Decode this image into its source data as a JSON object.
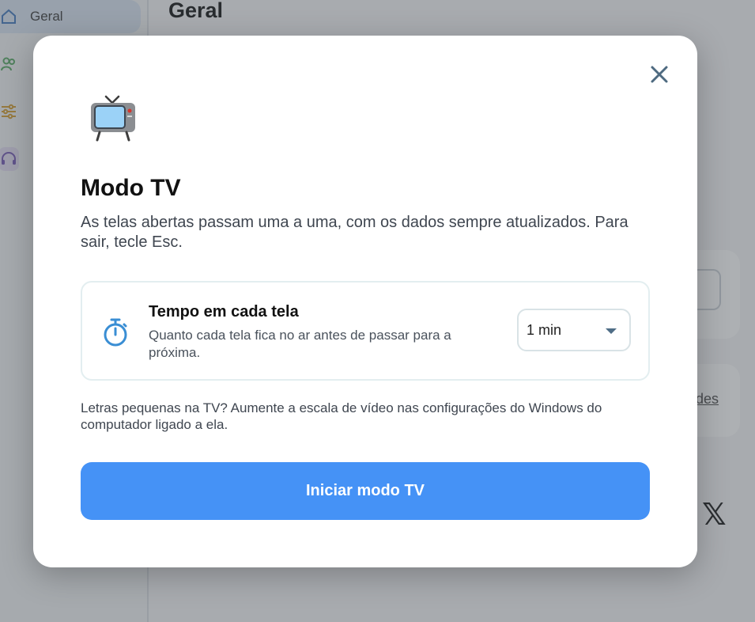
{
  "background": {
    "sidebar": {
      "items": [
        {
          "label": "Geral",
          "icon": "home-icon",
          "active": true
        },
        {
          "label": "",
          "icon": "users-icon"
        },
        {
          "label": "",
          "icon": "sliders-icon"
        },
        {
          "label": "",
          "icon": "headset-icon"
        }
      ]
    },
    "page_title": "Geral",
    "link_fragment": "des",
    "x_logo": "𝕏"
  },
  "modal": {
    "icon": "tv-icon",
    "close_icon": "close-icon",
    "title": "Modo TV",
    "description": "As telas abertas passam uma a uma, com os dados sempre atualizados. Para sair, tecle Esc.",
    "setting": {
      "icon": "timer-icon",
      "title": "Tempo em cada tela",
      "description": "Quanto cada tela fica no ar antes de passar para a próxima.",
      "select_value": "1 min"
    },
    "hint": "Letras pequenas na TV? Aumente a escala de vídeo nas configurações do Windows do computador ligado a ela.",
    "start_button_label": "Iniciar modo TV"
  },
  "colors": {
    "accent": "#4592f6",
    "overlay": "rgba(60,66,74,0.42)"
  }
}
